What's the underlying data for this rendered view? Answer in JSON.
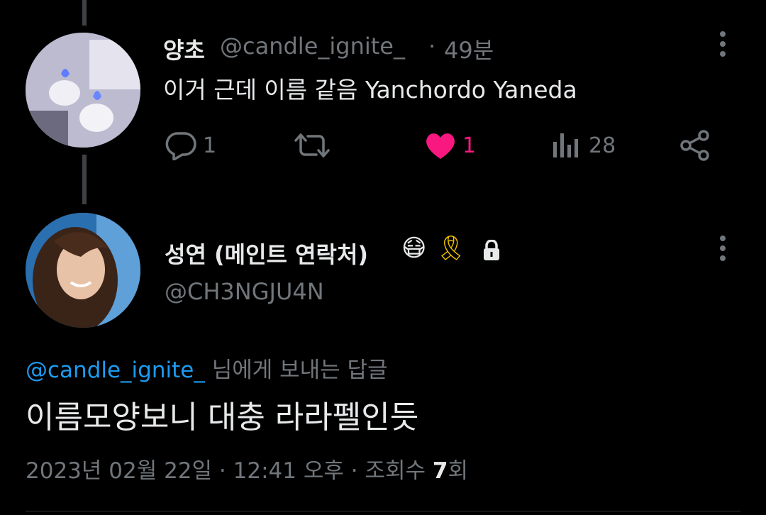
{
  "tweet1": {
    "display_name": "양초",
    "handle": "@candle_ignite_",
    "separator": "·",
    "time": "49분",
    "text": "이거 근데 이름 같음 Yanchordo Yaneda",
    "replies": "1",
    "likes": "1",
    "views": "28"
  },
  "tweet2": {
    "display_name": "성연 (메인트 연락처)",
    "emoji_mask": "😷",
    "emoji_ribbon": "🎗",
    "handle": "@CH3NGJU4N",
    "reply_to_handle": "@candle_ignite_",
    "reply_to_suffix": "님에게 보내는 답글",
    "text": "이름모양보니 대충 라라펠인듯",
    "date": "2023년 02월 22일",
    "sep1": "·",
    "time": "12:41 오후",
    "sep2": "·",
    "views_label": "조회수",
    "views_count": "7",
    "views_unit": "회"
  },
  "colors": {
    "like": "#f91880",
    "muted": "#71767b",
    "text": "#e7e9ea",
    "link": "#1d9bf0"
  }
}
